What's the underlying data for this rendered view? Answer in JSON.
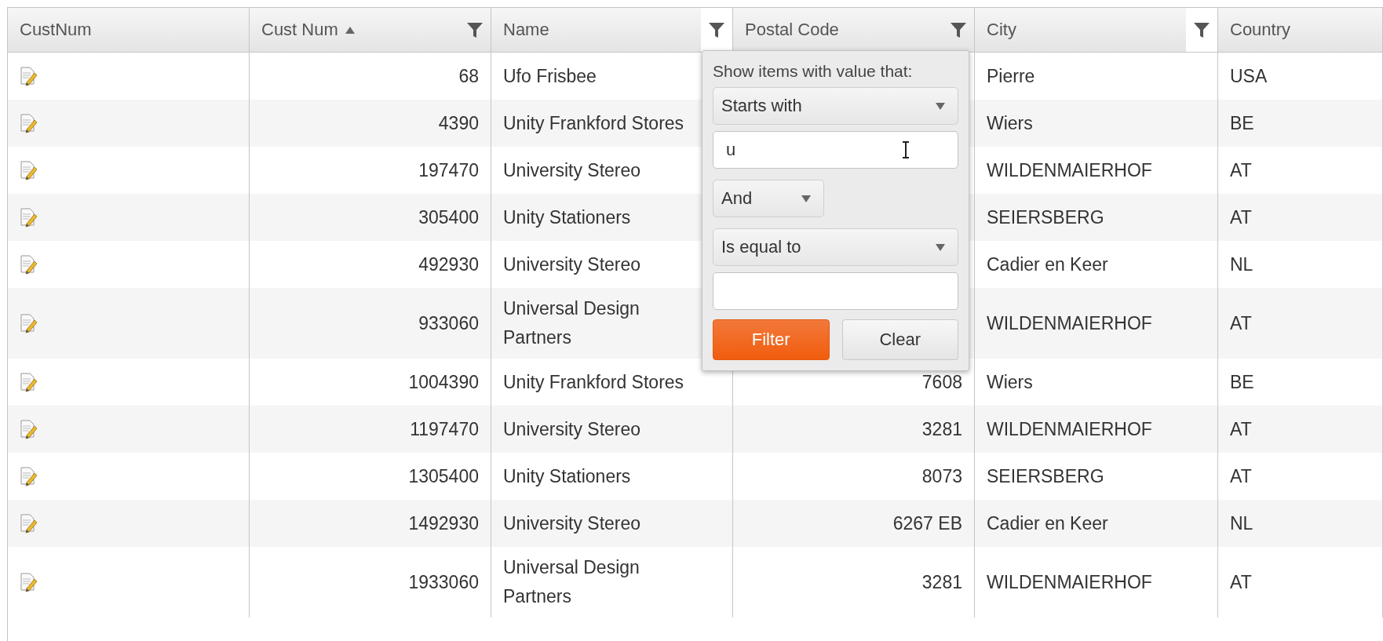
{
  "grid": {
    "columns": [
      {
        "label": "CustNum",
        "kind": "icon"
      },
      {
        "label": "Cust Num",
        "kind": "number",
        "sorted_ascending": true,
        "has_filter": true,
        "filter_highlighted": false
      },
      {
        "label": "Name",
        "kind": "text",
        "has_filter": true,
        "filter_highlighted": true
      },
      {
        "label": "Postal Code",
        "kind": "number",
        "has_filter": true,
        "filter_highlighted": false
      },
      {
        "label": "City",
        "kind": "text",
        "has_filter": true,
        "filter_highlighted": true
      },
      {
        "label": "Country",
        "kind": "text"
      }
    ],
    "rows": [
      {
        "cells": [
          null,
          "68",
          "Ufo Frisbee",
          null,
          "Pierre",
          "USA"
        ]
      },
      {
        "cells": [
          null,
          "4390",
          "Unity Frankford Stores",
          null,
          "Wiers",
          "BE"
        ]
      },
      {
        "cells": [
          null,
          "197470",
          "University Stereo",
          null,
          "WILDENMAIERHOF",
          "AT"
        ]
      },
      {
        "cells": [
          null,
          "305400",
          "Unity Stationers",
          null,
          "SEIERSBERG",
          "AT"
        ]
      },
      {
        "cells": [
          null,
          "492930",
          "University Stereo",
          null,
          "Cadier en Keer",
          "NL"
        ]
      },
      {
        "cells": [
          null,
          "933060",
          "Universal Design Partners",
          null,
          "WILDENMAIERHOF",
          "AT"
        ]
      },
      {
        "cells": [
          null,
          "1004390",
          "Unity Frankford Stores",
          "7608",
          "Wiers",
          "BE"
        ]
      },
      {
        "cells": [
          null,
          "1197470",
          "University Stereo",
          "3281",
          "WILDENMAIERHOF",
          "AT"
        ]
      },
      {
        "cells": [
          null,
          "1305400",
          "Unity Stationers",
          "8073",
          "SEIERSBERG",
          "AT"
        ]
      },
      {
        "cells": [
          null,
          "1492930",
          "University Stereo",
          "6267 EB",
          "Cadier en Keer",
          "NL"
        ]
      },
      {
        "cells": [
          null,
          "1933060",
          "Universal Design Partners",
          "3281",
          "WILDENMAIERHOF",
          "AT"
        ]
      }
    ]
  },
  "filter_menu": {
    "prompt": "Show items with value that:",
    "operator_1": "Starts with",
    "value_1": "u",
    "logic": "And",
    "operator_2": "Is equal to",
    "buttons": [
      {
        "label": "Filter",
        "kind": "primary"
      },
      {
        "label": "Clear",
        "kind": "secondary"
      }
    ]
  }
}
